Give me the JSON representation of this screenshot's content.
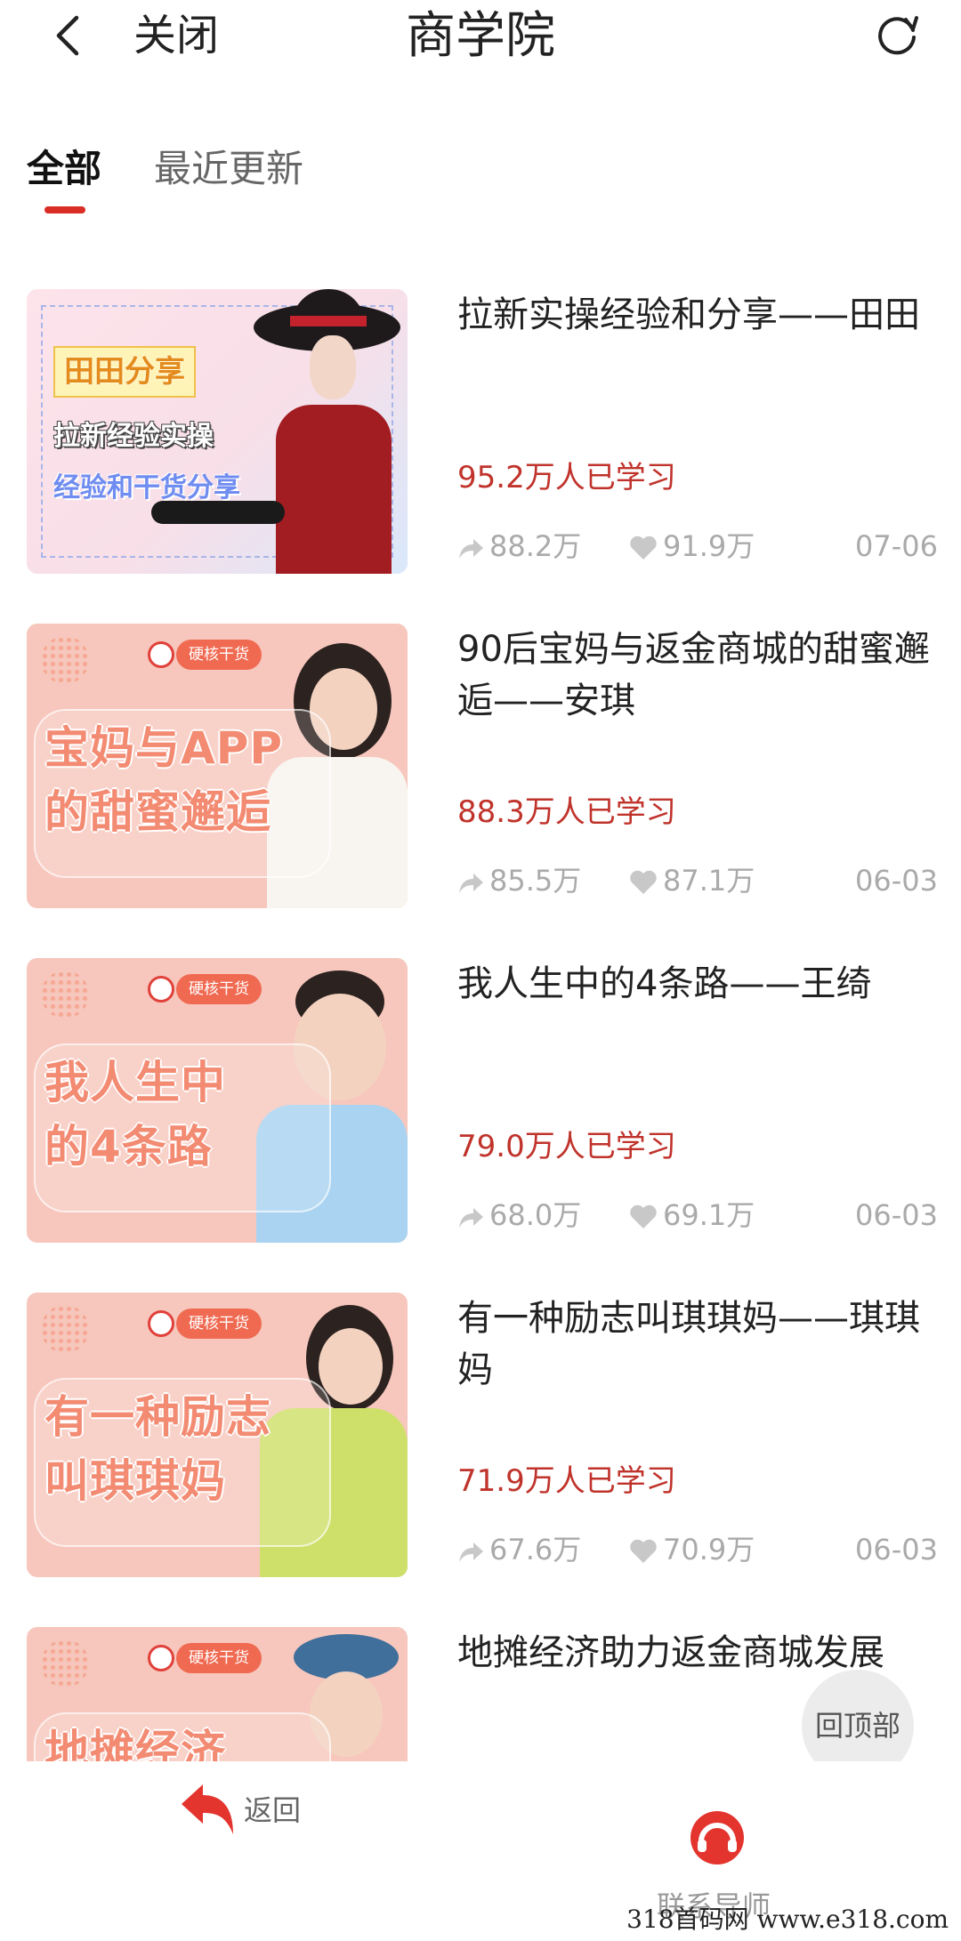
{
  "header": {
    "close_label": "关闭",
    "title": "商学院"
  },
  "tabs": [
    {
      "label": "全部",
      "active": true
    },
    {
      "label": "最近更新",
      "active": false
    }
  ],
  "courses": [
    {
      "title": "拉新实操经验和分享——田田",
      "thumb_lines": [
        "田田分享",
        "拉新经验实操",
        "经验和干货分享"
      ],
      "learners": "95.2万人已学习",
      "shares": "88.2万",
      "likes": "91.9万",
      "date": "07-06"
    },
    {
      "title": "90后宝妈与返金商城的甜蜜邂逅——安琪",
      "thumb_badge": "硬核干货",
      "thumb_lines": [
        "宝妈与APP",
        "的甜蜜邂逅"
      ],
      "learners": "88.3万人已学习",
      "shares": "85.5万",
      "likes": "87.1万",
      "date": "06-03"
    },
    {
      "title": "我人生中的4条路——王绮",
      "thumb_badge": "硬核干货",
      "thumb_lines": [
        "我人生中",
        "的4条路"
      ],
      "learners": "79.0万人已学习",
      "shares": "68.0万",
      "likes": "69.1万",
      "date": "06-03"
    },
    {
      "title": "有一种励志叫琪琪妈——琪琪妈",
      "thumb_badge": "硬核干货",
      "thumb_lines": [
        "有一种励志",
        "叫琪琪妈"
      ],
      "learners": "71.9万人已学习",
      "shares": "67.6万",
      "likes": "70.9万",
      "date": "06-03"
    },
    {
      "title": "地摊经济助力返金商城发展",
      "thumb_badge": "硬核干货",
      "thumb_lines": [
        "地摊经济"
      ]
    }
  ],
  "back_to_top_label": "回顶部",
  "bottom_bar": {
    "return_label": "返回",
    "mentor_label": "联系导师"
  },
  "watermark": "318首码网  www.e318.com",
  "colors": {
    "accent": "#d92d26",
    "learners_text": "#c0332b",
    "thumb_bg": "#f7c7bd"
  }
}
